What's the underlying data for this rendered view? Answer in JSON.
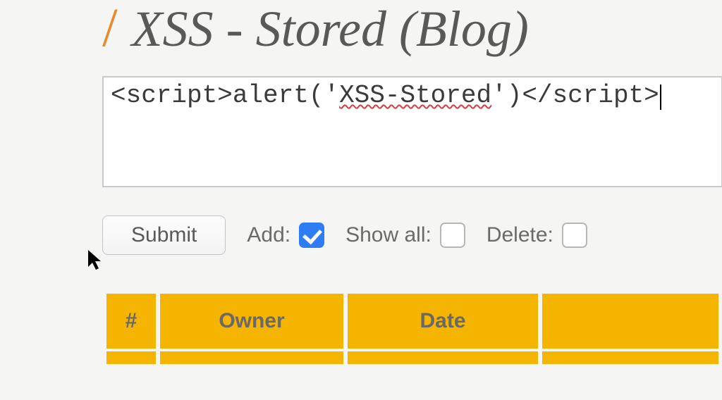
{
  "header": {
    "slash": "/",
    "title": "XSS - Stored (Blog)"
  },
  "entry": {
    "prefix": "<script>alert('",
    "spelled": "XSS-Stored",
    "suffix": "')</script>"
  },
  "controls": {
    "submit_label": "Submit",
    "add_label": "Add:",
    "add_checked": true,
    "showall_label": "Show all:",
    "showall_checked": false,
    "delete_label": "Delete:",
    "delete_checked": false
  },
  "table": {
    "columns": {
      "num": "#",
      "owner": "Owner",
      "date": "Date",
      "rest": ""
    }
  }
}
